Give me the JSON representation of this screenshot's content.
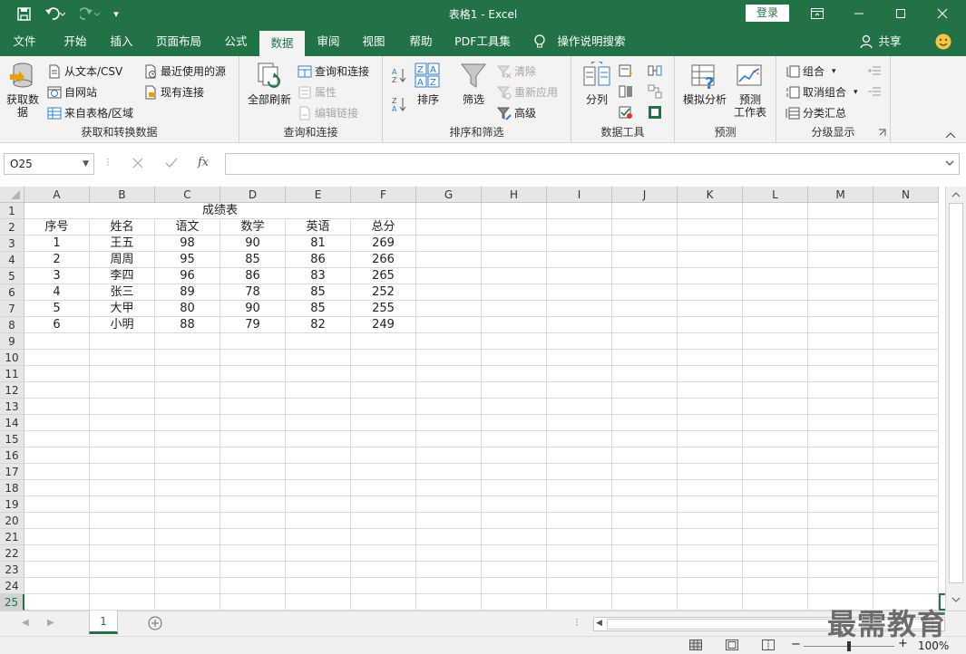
{
  "title_bar": {
    "window_title": "表格1 - Excel",
    "login_label": "登录",
    "customize_glyph": "▾"
  },
  "tabs": [
    {
      "label": "文件"
    },
    {
      "label": "开始"
    },
    {
      "label": "插入"
    },
    {
      "label": "页面布局"
    },
    {
      "label": "公式"
    },
    {
      "label": "数据",
      "active": true
    },
    {
      "label": "审阅"
    },
    {
      "label": "视图"
    },
    {
      "label": "帮助"
    },
    {
      "label": "PDF工具集"
    },
    {
      "label": "操作说明搜索"
    }
  ],
  "share_label": "共享",
  "ribbon": {
    "get_data": {
      "big_button": "获取数据",
      "items": [
        "从文本/CSV",
        "自网站",
        "来自表格/区域",
        "最近使用的源",
        "现有连接"
      ],
      "label": "获取和转换数据"
    },
    "queries": {
      "big_button": "全部刷新",
      "items": [
        "查询和连接",
        "属性",
        "编辑链接"
      ],
      "label": "查询和连接"
    },
    "sort_filter": {
      "sort_label": "排序",
      "filter_label": "筛选",
      "items": [
        "清除",
        "重新应用",
        "高级"
      ],
      "label": "排序和筛选"
    },
    "data_tools": {
      "split_label": "分列",
      "label": "数据工具"
    },
    "forecast": {
      "what_if_label": "模拟分析",
      "forecast_line1": "预测",
      "forecast_line2": "工作表",
      "label": "预测"
    },
    "outline": {
      "items": [
        "组合",
        "取消组合",
        "分类汇总"
      ],
      "label": "分级显示"
    }
  },
  "formula_bar": {
    "name_box": "O25",
    "fx": "fx",
    "value": ""
  },
  "columns": [
    "A",
    "B",
    "C",
    "D",
    "E",
    "F",
    "G",
    "H",
    "I",
    "J",
    "K",
    "L",
    "M",
    "N"
  ],
  "rows": [
    "1",
    "2",
    "3",
    "4",
    "5",
    "6",
    "7",
    "8",
    "9",
    "10",
    "11",
    "12",
    "13",
    "14",
    "15",
    "16",
    "17",
    "18",
    "19",
    "20",
    "21",
    "22",
    "23",
    "24",
    "25"
  ],
  "selected_row": "25",
  "sheet": {
    "title": "成绩表",
    "headers": [
      "序号",
      "姓名",
      "语文",
      "数学",
      "英语",
      "总分"
    ],
    "records": [
      [
        "1",
        "王五",
        "98",
        "90",
        "81",
        "269"
      ],
      [
        "2",
        "周周",
        "95",
        "85",
        "86",
        "266"
      ],
      [
        "3",
        "李四",
        "96",
        "86",
        "83",
        "265"
      ],
      [
        "4",
        "张三",
        "89",
        "78",
        "85",
        "252"
      ],
      [
        "5",
        "大甲",
        "80",
        "90",
        "85",
        "255"
      ],
      [
        "6",
        "小明",
        "88",
        "79",
        "82",
        "249"
      ]
    ]
  },
  "sheet_tabs": [
    {
      "label": "1"
    }
  ],
  "status": {
    "zoom_minus": "−",
    "zoom_plus": "+",
    "zoom_level": "100%",
    "zoom_fraction": 0.5
  },
  "watermark": "最需教育",
  "colors": {
    "excel_green": "#217346",
    "ribbon_bg": "#f3f3f3"
  }
}
